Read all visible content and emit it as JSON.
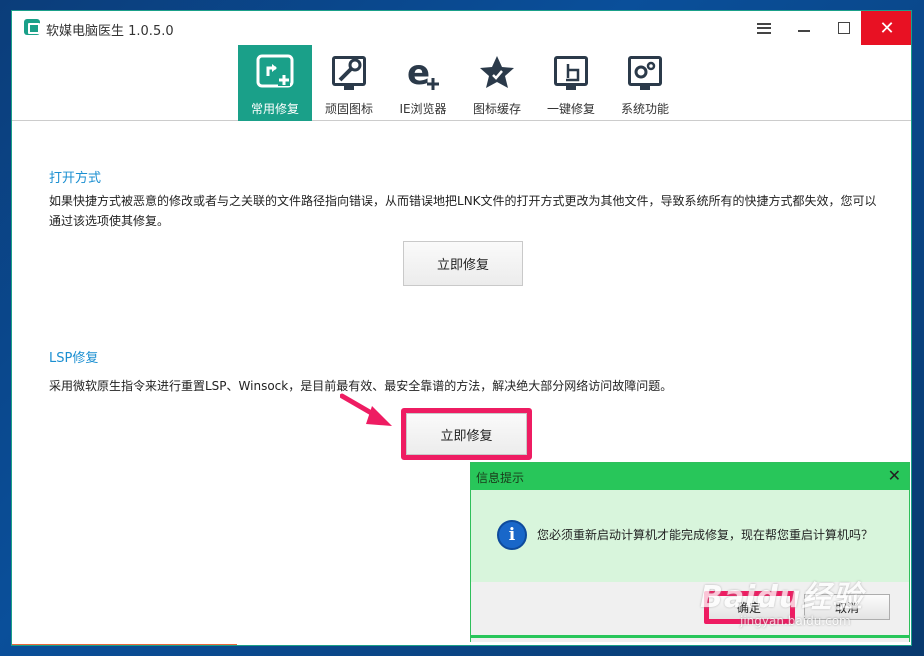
{
  "window": {
    "title": "软媒电脑医生 1.0.5.0",
    "accent": "#1aa089",
    "close_symbol": "✕"
  },
  "toolbar": {
    "items": [
      {
        "label": "常用修复",
        "icon": "repair-icon",
        "active": true
      },
      {
        "label": "顽固图标",
        "icon": "wrench-icon",
        "active": false
      },
      {
        "label": "IE浏览器",
        "icon": "ie-icon",
        "active": false
      },
      {
        "label": "图标缓存",
        "icon": "star-icon",
        "active": false
      },
      {
        "label": "一键修复",
        "icon": "hand-click-icon",
        "active": false
      },
      {
        "label": "系统功能",
        "icon": "gears-icon",
        "active": false
      }
    ]
  },
  "sections": {
    "open_method": {
      "title": "打开方式",
      "description": "如果快捷方式被恶意的修改或者与之关联的文件路径指向错误，从而错误地把LNK文件的打开方式更改为其他文件，导致系统所有的快捷方式都失效，您可以通过该选项使其修复。",
      "button": "立即修复"
    },
    "lsp": {
      "title": "LSP修复",
      "description": "采用微软原生指令来进行重置LSP、Winsock，是目前最有效、最安全靠谱的方法，解决绝大部分网络访问故障问题。",
      "button": "立即修复"
    }
  },
  "dialog": {
    "title": "信息提示",
    "close_symbol": "✕",
    "message": "您必须重新启动计算机才能完成修复，现在帮您重启计算机吗？",
    "info_symbol": "i",
    "ok_label": "确定",
    "cancel_label": "取消"
  },
  "watermark": {
    "brand": "Baidu经验",
    "url": "jingyan.baidu.com"
  },
  "colors": {
    "section_title": "#1b8fd1",
    "highlight": "#ee1c62",
    "dialog_green": "#28c65a",
    "close_red": "#e81123"
  }
}
